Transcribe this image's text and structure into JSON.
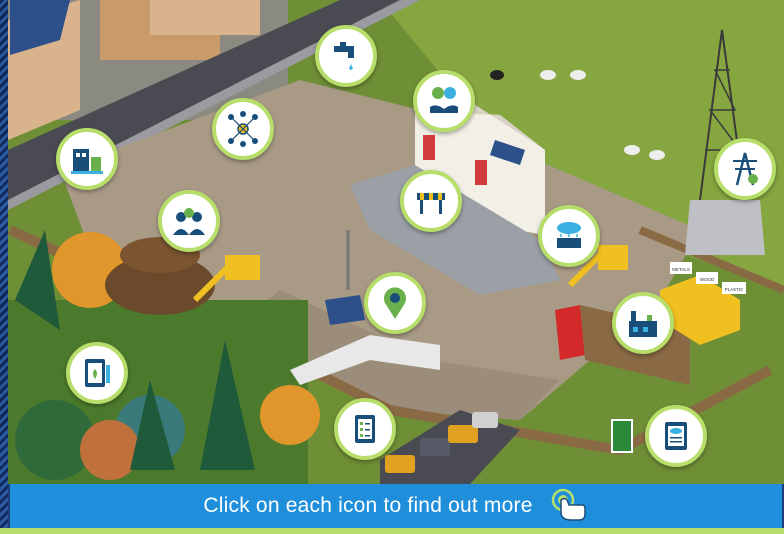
{
  "banner": {
    "text": "Click on each icon to find out more"
  },
  "signs": {
    "metals": "METALS",
    "wood": "WOOD",
    "plastic": "PLASTIC"
  },
  "colors": {
    "accent_green": "#b7dd6a",
    "banner_blue": "#1f8fdc",
    "icon_stroke": "#1a4e7a"
  },
  "hotspots": [
    {
      "name": "water-tap-icon"
    },
    {
      "name": "money-hands-icon"
    },
    {
      "name": "network-lightbulb-icon"
    },
    {
      "name": "site-building-icon"
    },
    {
      "name": "workers-group-icon"
    },
    {
      "name": "road-barrier-icon"
    },
    {
      "name": "weather-station-icon"
    },
    {
      "name": "power-pylon-icon"
    },
    {
      "name": "location-pin-icon"
    },
    {
      "name": "factory-icon"
    },
    {
      "name": "clipboard-plant-icon"
    },
    {
      "name": "checklist-icon"
    },
    {
      "name": "co2-report-icon"
    }
  ]
}
